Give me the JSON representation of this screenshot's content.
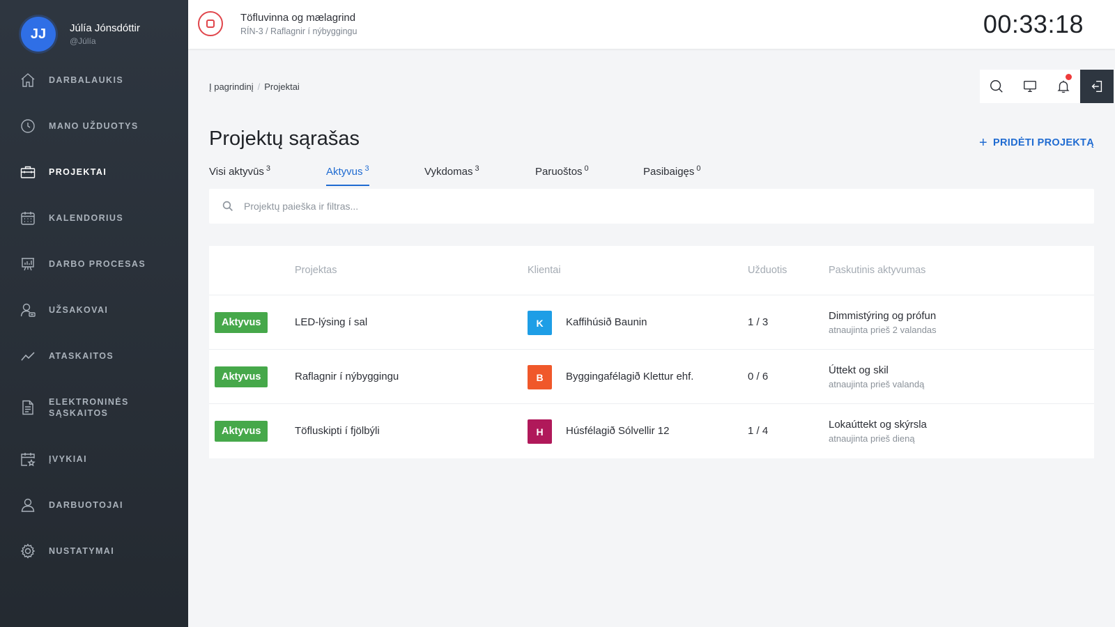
{
  "user": {
    "initials": "JJ",
    "name": "Júlía Jónsdóttir",
    "handle": "@Júlía",
    "avatar_color": "#2f6fe6"
  },
  "nav": [
    {
      "label": "DARBALAUKIS",
      "icon": "home-icon"
    },
    {
      "label": "MANO UŽDUOTYS",
      "icon": "clock-icon"
    },
    {
      "label": "PROJEKTAI",
      "icon": "briefcase-icon",
      "active": true
    },
    {
      "label": "KALENDORIUS",
      "icon": "calendar-icon"
    },
    {
      "label": "DARBO PROCESAS",
      "icon": "presentation-board-icon"
    },
    {
      "label": "UŽSAKOVAI",
      "icon": "user-card-icon"
    },
    {
      "label": "ATASKAITOS",
      "icon": "trend-line-icon"
    },
    {
      "label": "ELEKTRONINĖS SĄSKAITOS",
      "icon": "document-icon"
    },
    {
      "label": "ĮVYKIAI",
      "icon": "calendar-star-icon"
    },
    {
      "label": "DARBUOTOJAI",
      "icon": "users-icon"
    },
    {
      "label": "NUSTATYMAI",
      "icon": "gear-icon"
    }
  ],
  "topbar": {
    "task_title": "Töfluvinna og mælagrind",
    "task_sub": "RÍN-3 / Raflagnir í nýbyggingu",
    "timer": "00:33:18"
  },
  "breadcrumb": {
    "home": "Į pagrindinį",
    "separator": "/",
    "current": "Projektai"
  },
  "page": {
    "title": "Projektų sąrašas",
    "add_button": "PRIDĖTI PROJEKTĄ"
  },
  "tabs": [
    {
      "label": "Visi aktyvūs",
      "count": "3"
    },
    {
      "label": "Aktyvus",
      "count": "3",
      "active": true
    },
    {
      "label": "Vykdomas",
      "count": "3"
    },
    {
      "label": "Paruoštos",
      "count": "0"
    },
    {
      "label": "Pasibaigęs",
      "count": "0"
    }
  ],
  "search": {
    "placeholder": "Projektų paieška ir filtras..."
  },
  "table": {
    "headers": {
      "project": "Projektas",
      "client": "Klientai",
      "tasks": "Užduotis",
      "activity": "Paskutinis aktyvumas"
    },
    "rows": [
      {
        "status": "Aktyvus",
        "project": "LED-lýsing í sal",
        "client_initial": "K",
        "client_color": "#1e9ee6",
        "client": "Kaffihúsið Baunin",
        "tasks": "1 / 3",
        "activity": "Dimmistýring og prófun",
        "activity_time": "atnaujinta prieš 2 valandas"
      },
      {
        "status": "Aktyvus",
        "project": "Raflagnir í nýbyggingu",
        "client_initial": "B",
        "client_color": "#f0582a",
        "client": "Byggingafélagið Klettur ehf.",
        "tasks": "0 / 6",
        "activity": "Úttekt og skil",
        "activity_time": "atnaujinta prieš valandą"
      },
      {
        "status": "Aktyvus",
        "project": "Töfluskipti í fjölbýli",
        "client_initial": "H",
        "client_color": "#b0195a",
        "client": "Húsfélagið Sólvellir 12",
        "tasks": "1 / 4",
        "activity": "Lokaúttekt og skýrsla",
        "activity_time": "atnaujinta prieš dieną"
      }
    ]
  },
  "colors": {
    "accent": "#1f6bd1",
    "status_active": "#46a84a",
    "stop": "#e0454b",
    "notification": "#ee3b3b"
  }
}
